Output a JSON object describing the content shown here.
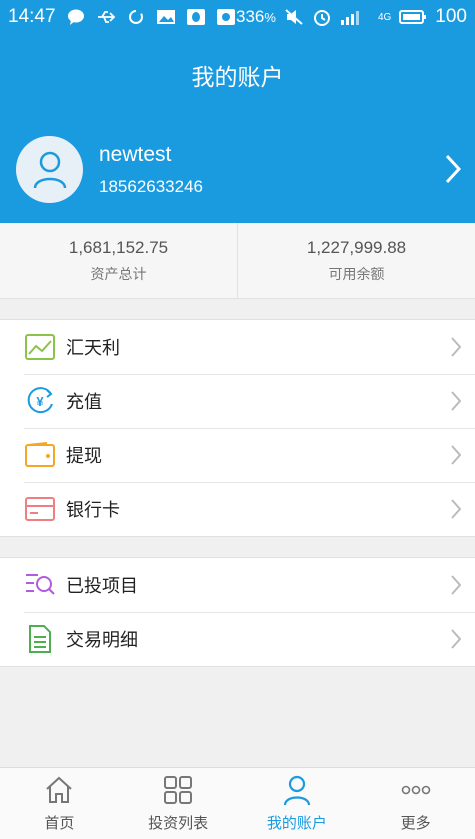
{
  "status_bar": {
    "time": "14:47",
    "speed": "336",
    "speed_unit": "%",
    "battery": "100",
    "network": "4G"
  },
  "header": {
    "title": "我的账户"
  },
  "profile": {
    "username": "newtest",
    "phone": "18562633246"
  },
  "stats": [
    {
      "value": "1,681,152.75",
      "label": "资产总计"
    },
    {
      "value": "1,227,999.88",
      "label": "可用余额"
    }
  ],
  "menu_group_1": [
    {
      "label": "汇天利",
      "icon": "chart-icon"
    },
    {
      "label": "充值",
      "icon": "yuan-recharge-icon"
    },
    {
      "label": "提现",
      "icon": "wallet-icon"
    },
    {
      "label": "银行卡",
      "icon": "bank-card-icon"
    }
  ],
  "menu_group_2": [
    {
      "label": "已投项目",
      "icon": "list-search-icon"
    },
    {
      "label": "交易明细",
      "icon": "document-icon"
    }
  ],
  "tabs": [
    {
      "label": "首页",
      "icon": "home-icon"
    },
    {
      "label": "投资列表",
      "icon": "grid-icon"
    },
    {
      "label": "我的账户",
      "icon": "person-icon",
      "active": true
    },
    {
      "label": "更多",
      "icon": "more-icon"
    }
  ],
  "colors": {
    "primary": "#1a9be0",
    "background": "#f0f0f0",
    "chart_icon": "#8bc34a",
    "wallet_icon": "#f5a623",
    "card_icon": "#ef7f7f",
    "list_icon": "#b05be0",
    "doc_icon": "#4caf50"
  }
}
